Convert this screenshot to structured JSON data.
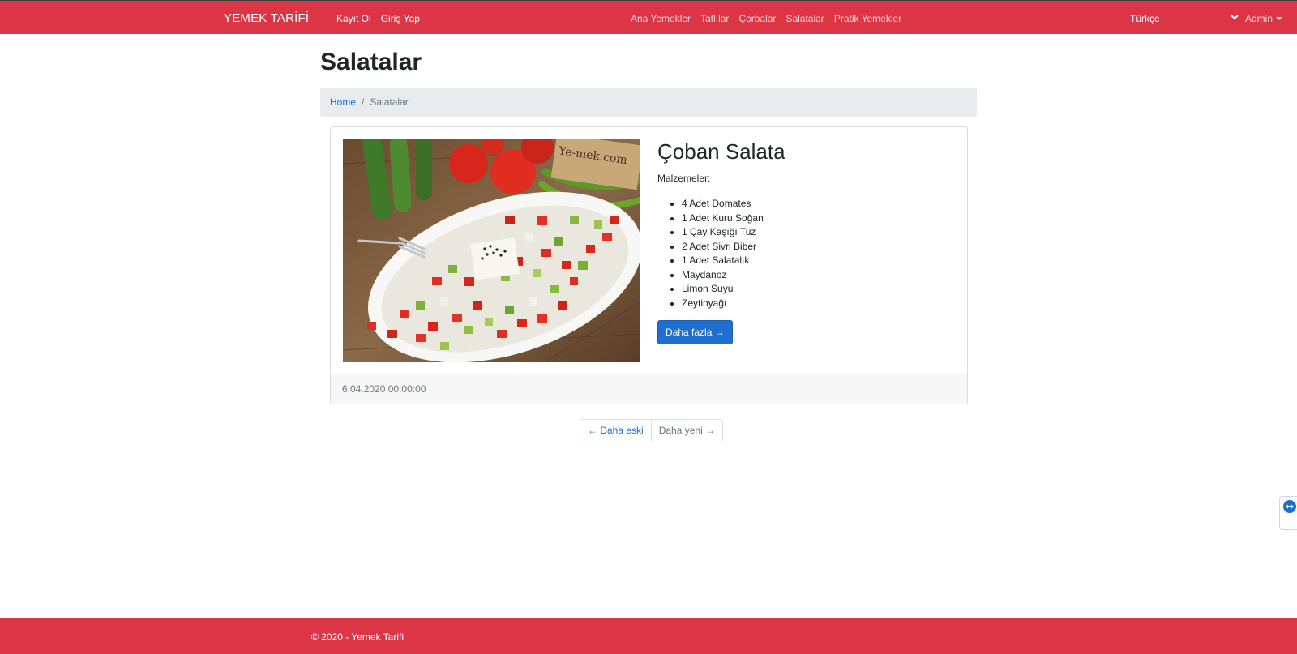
{
  "navbar": {
    "brand": "YEMEK TARİFİ",
    "left_links": [
      "Kayıt Ol",
      "Giriş Yap"
    ],
    "center_links": [
      "Ana Yemekler",
      "Tatlılar",
      "Çorbalar",
      "Salatalar",
      "Pratik Yemekler"
    ],
    "language": "Türkçe",
    "user_menu": "Admin",
    "background_color": "#dc3545"
  },
  "page": {
    "title": "Salatalar",
    "breadcrumb": {
      "home": "Home",
      "separator": "/",
      "current": "Salatalar"
    }
  },
  "recipe": {
    "title": "Çoban Salata",
    "ingredients_label": "Malzemeler:",
    "ingredients": [
      "4 Adet Domates",
      "1 Adet Kuru Soğan",
      "1 Çay Kaşığı Tuz",
      "2 Adet Sivri Biber",
      "1 Adet Salatalık",
      "Maydanoz",
      "Limon Suyu",
      "Zeytinyağı"
    ],
    "more_button": "Daha fazla →",
    "date": "6.04.2020 00:00:00",
    "image_watermark": "Ye-mek.com"
  },
  "pager": {
    "older": "← Daha eski",
    "newer": "Daha yeni →"
  },
  "footer": {
    "text": "© 2020 - Yemek Tarifi"
  }
}
